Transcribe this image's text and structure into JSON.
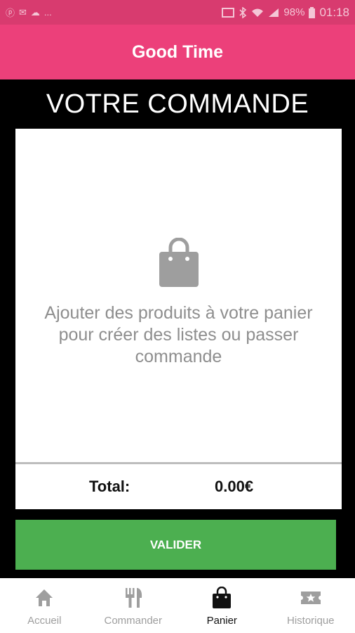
{
  "status_bar": {
    "left_glyphs": [
      "ⓟ",
      "✉",
      "☁",
      "..."
    ],
    "battery": "98%",
    "time": "01:18"
  },
  "app_bar": {
    "title": "Good Time"
  },
  "page": {
    "heading": "VOTRE COMMANDE"
  },
  "cart": {
    "icon": "shopping-bag-icon",
    "empty_message": "Ajouter des produits à votre panier pour créer des listes ou passer commande",
    "total_label": "Total:",
    "total_value": "0.00€"
  },
  "actions": {
    "validate_label": "VALIDER"
  },
  "bottom_nav": {
    "items": [
      {
        "label": "Accueil",
        "icon": "home-icon",
        "active": false
      },
      {
        "label": "Commander",
        "icon": "fork-knife-icon",
        "active": false
      },
      {
        "label": "Panier",
        "icon": "shopping-bag-icon",
        "active": true
      },
      {
        "label": "Historique",
        "icon": "ticket-star-icon",
        "active": false
      }
    ]
  },
  "colors": {
    "status_bar": "#d83b6f",
    "app_bar": "#ec407a",
    "validate_button": "#4caf50",
    "inactive_nav": "#9e9e9e"
  }
}
